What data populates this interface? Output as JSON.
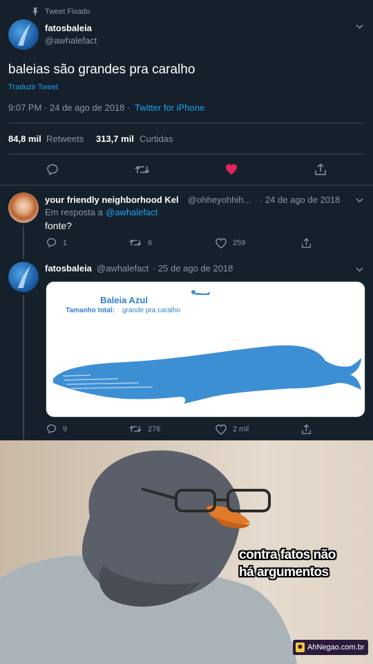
{
  "pinned": {
    "label": "Tweet Fixado",
    "icon": "pin-icon"
  },
  "main_tweet": {
    "name": "fatosbaleia",
    "handle": "@awhalefact",
    "text": "baleias são grandes pra caralho",
    "translate": "Traduzir Tweet",
    "time": "9:07 PM · 24 de ago de 2018 ·",
    "source": "Twitter for iPhone",
    "retweets_count": "84,8 mil",
    "retweets_label": "Retweets",
    "likes_count": "313,7 mil",
    "likes_label": "Curtidas"
  },
  "reply": {
    "name": "your friendly neighborhood Kel",
    "handle": "@ohheyohhih...",
    "date": "· 24 de ago de 2018",
    "reply_to_label": "Em resposta a",
    "reply_to_handle": "@awhalefact",
    "text": "fonte?",
    "replies": "1",
    "retweets": "6",
    "likes": "259"
  },
  "reply2": {
    "name": "fatosbaleia",
    "handle": "@awhalefact",
    "date": "· 25 de ago de 2018",
    "card_title": "Baleia Azul",
    "card_size_label": "Tamanho total:",
    "card_size_value": "grande pra caralho",
    "replies": "9",
    "retweets": "276",
    "likes": "2 mil"
  },
  "meme": {
    "caption_line1": "contra fatos não",
    "caption_line2": "há argumentos",
    "watermark": "AhNegao.com.br"
  },
  "colors": {
    "background": "#15202b",
    "accent": "#1da1f2",
    "like": "#e0245e",
    "muted": "#8899a6",
    "whale": "#3d8fd4"
  }
}
